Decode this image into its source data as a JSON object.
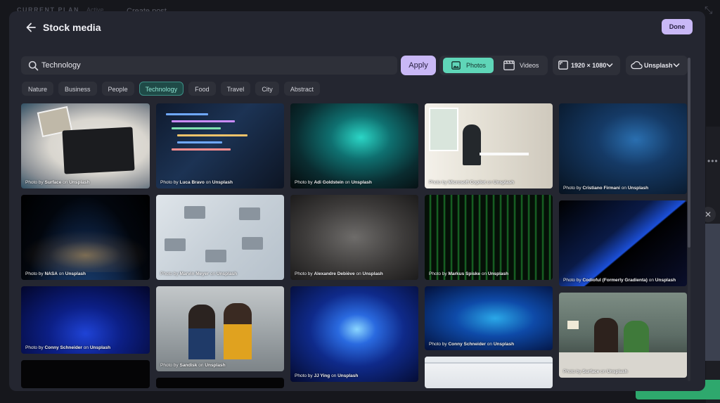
{
  "background": {
    "plan_label": "CURRENT PLAN",
    "plan_status": "Active",
    "create_post": "Create post"
  },
  "modal": {
    "title": "Stock media",
    "done_label": "Done"
  },
  "search": {
    "value": "Technology",
    "placeholder": "Search",
    "apply_label": "Apply"
  },
  "media_type": {
    "photos_label": "Photos",
    "videos_label": "Videos",
    "selected": "Photos"
  },
  "resolution": {
    "value": "1920 × 1080"
  },
  "source": {
    "value": "Unsplash"
  },
  "categories": [
    {
      "label": "Nature",
      "active": false
    },
    {
      "label": "Business",
      "active": false
    },
    {
      "label": "People",
      "active": false
    },
    {
      "label": "Technology",
      "active": true
    },
    {
      "label": "Food",
      "active": false
    },
    {
      "label": "Travel",
      "active": false
    },
    {
      "label": "City",
      "active": false
    },
    {
      "label": "Abstract",
      "active": false
    }
  ],
  "photos": [
    {
      "author": "Surface",
      "source": "Unsplash",
      "prefix": "Photo by",
      "joiner": "on"
    },
    {
      "author": "NASA",
      "source": "Unsplash",
      "prefix": "Photo by",
      "joiner": "on"
    },
    {
      "author": "Conny Schneider",
      "source": "Unsplash",
      "prefix": "Photo by",
      "joiner": "on"
    },
    {
      "author": "Luca Bravo",
      "source": "Unsplash",
      "prefix": "Photo by",
      "joiner": "on"
    },
    {
      "author": "Marvin Meyer",
      "source": "Unsplash",
      "prefix": "Photo by",
      "joiner": "on"
    },
    {
      "author": "Sandisk",
      "source": "Unsplash",
      "prefix": "Photo by",
      "joiner": "on"
    },
    {
      "author": "Adi Goldstein",
      "source": "Unsplash",
      "prefix": "Photo by",
      "joiner": "on"
    },
    {
      "author": "Alexandre Debiève",
      "source": "Unsplash",
      "prefix": "Photo by",
      "joiner": "on"
    },
    {
      "author": "JJ Ying",
      "source": "Unsplash",
      "prefix": "Photo by",
      "joiner": "on"
    },
    {
      "author": "Microsoft Copilot",
      "source": "Unsplash",
      "prefix": "Photo by",
      "joiner": "on"
    },
    {
      "author": "Markus Spiske",
      "source": "Unsplash",
      "prefix": "Photo by",
      "joiner": "on"
    },
    {
      "author": "Conny Schneider",
      "source": "Unsplash",
      "prefix": "Photo by",
      "joiner": "on"
    },
    {
      "author": "Cristiano Firmani",
      "source": "Unsplash",
      "prefix": "Photo by",
      "joiner": "on"
    },
    {
      "author": "Codioful (Formerly Gradienta)",
      "source": "Unsplash",
      "prefix": "Photo by",
      "joiner": "on"
    },
    {
      "author": "Surface",
      "source": "Unsplash",
      "prefix": "Photo by",
      "joiner": "on"
    }
  ],
  "colors": {
    "accent": "#c9b8f6",
    "photos_active": "#5fd6b8",
    "chip_active": "#8ee4d2",
    "modal_bg": "#242630"
  },
  "icons": {
    "back": "arrow-left-icon",
    "search": "search-icon",
    "photos": "image-icon",
    "videos": "film-icon",
    "resolution": "aspect-ratio-icon",
    "source": "cloud-icon",
    "dropdown": "chevron-down-icon"
  }
}
